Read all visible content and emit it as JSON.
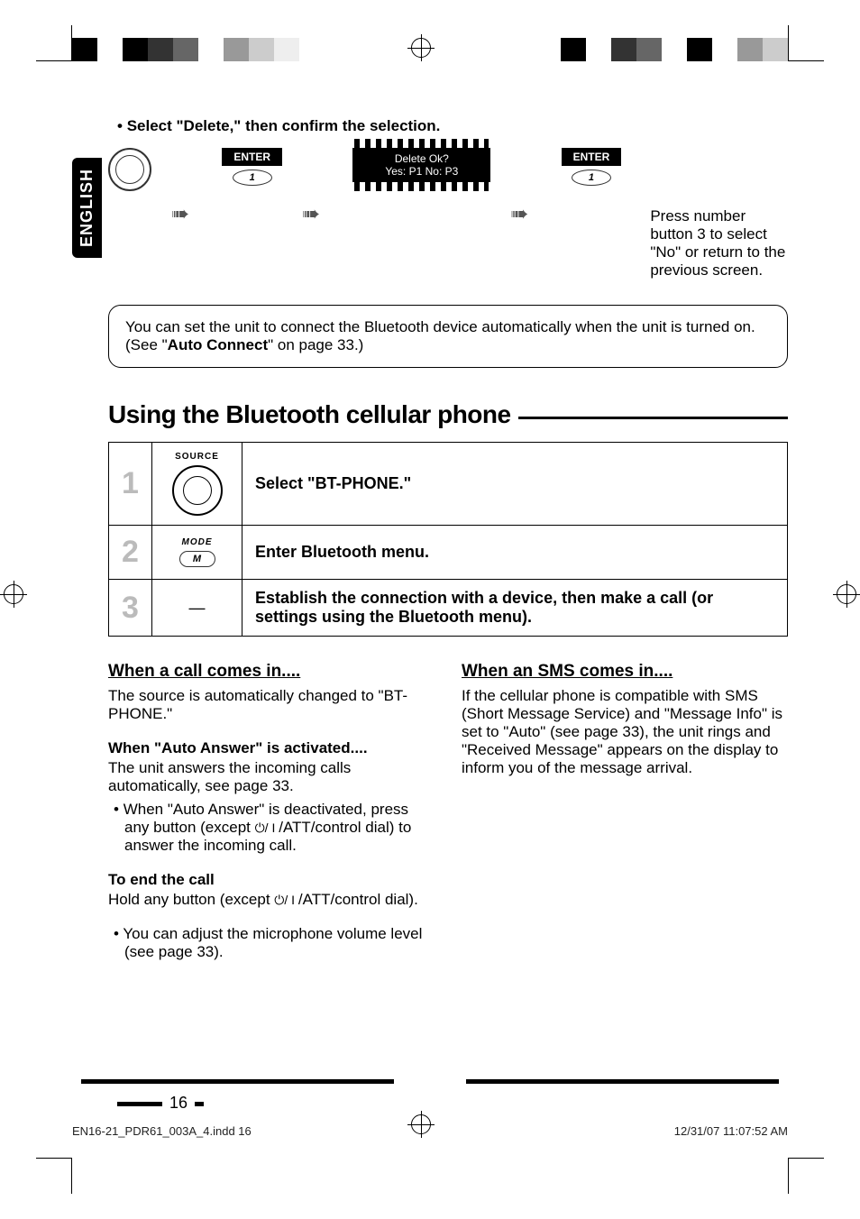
{
  "language_tab": "ENGLISH",
  "lead_bullet": "Select \"Delete,\" then confirm the selection.",
  "illus": {
    "enter_label": "ENTER",
    "btn_1": "1",
    "lcd_line1": "Delete Ok?",
    "lcd_line2": "Yes: P1    No: P3",
    "sidenote": "Press number button 3 to select \"No\" or return to the previous screen."
  },
  "note_box": {
    "pre": "You can set the unit to connect the Bluetooth device automatically when the unit is turned on. (See \"",
    "bold": "Auto Connect",
    "post": "\" on page 33.)"
  },
  "section_title": "Using the Bluetooth cellular phone",
  "steps": [
    {
      "num": "1",
      "icon_top": "SOURCE",
      "icon_kind": "dial",
      "desc": "Select \"BT-PHONE.\""
    },
    {
      "num": "2",
      "icon_top": "MODE",
      "icon_kind": "mbtn",
      "icon_btn": "M",
      "desc": "Enter Bluetooth menu."
    },
    {
      "num": "3",
      "icon_top": "",
      "icon_kind": "dash",
      "desc": "Establish the connection with a device, then make a call (or settings using the Bluetooth menu)."
    }
  ],
  "left_col": {
    "h1": "When a call comes in....",
    "p1": "The source is automatically changed to \"BT-PHONE.\"",
    "h2": "When \"Auto Answer\" is activated....",
    "p2": "The unit answers the incoming calls automatically, see page 33.",
    "b1a": "When \"Auto Answer\" is deactivated, press any button (except ",
    "b1b": "/ATT/control dial) to answer the incoming call.",
    "h3": "To end the call",
    "p3a": "Hold any button (except ",
    "p3b": "/ATT/control dial).",
    "b2": "You can adjust the microphone volume level (see page 33)."
  },
  "right_col": {
    "h1": "When an SMS comes in....",
    "p1": "If the cellular phone is compatible with SMS (Short Message Service) and \"Message Info\" is set to \"Auto\" (see page 33), the unit rings and \"Received Message\" appears on the display to inform you of the message arrival."
  },
  "page_number": "16",
  "footer_file": "EN16-21_PDR61_003A_4.indd   16",
  "footer_time": "12/31/07   11:07:52 AM"
}
